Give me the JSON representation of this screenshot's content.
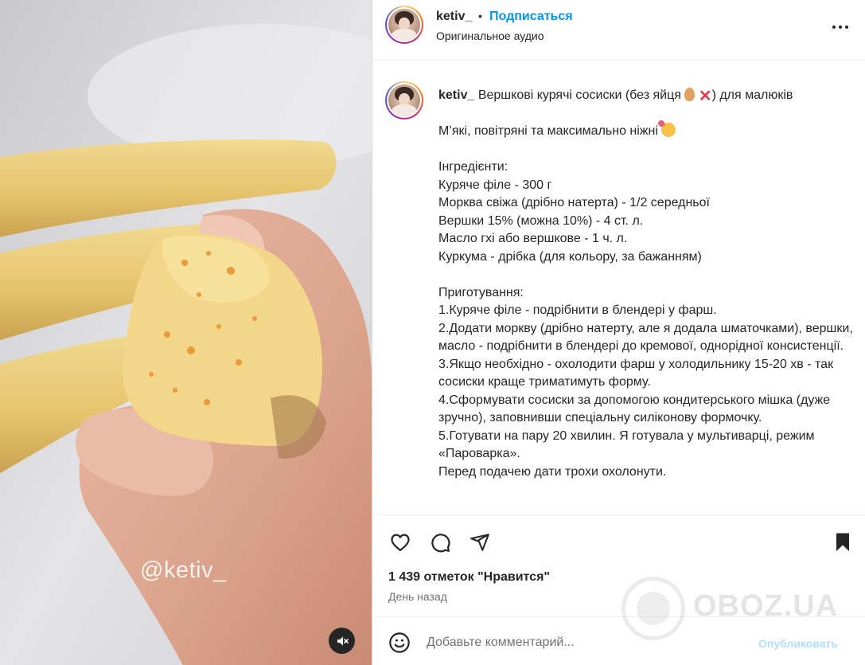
{
  "media": {
    "watermark_handle": "@ketiv_"
  },
  "header": {
    "username": "ketiv_",
    "separator": "•",
    "follow_label": "Подписаться",
    "audio_label": "Оригинальное аудио"
  },
  "caption": {
    "username": "ketiv_",
    "title_before": "Вершкові курячі сосиски (без яйця ",
    "title_after": ") для малюків",
    "tagline": "М’які, повітряні та максимально ніжні",
    "ingredients_header": "Інгредієнти:",
    "ingredients": [
      "Куряче філе - 300 г",
      "Морква свіжа (дрібно натерта) - 1/2 середньої",
      "Вершки 15% (можна 10%) - 4 ст. л.",
      "Масло гхі або вершкове - 1 ч. л.",
      "Куркума - дрібка (для кольору, за бажанням)"
    ],
    "steps_header": "Приготування:",
    "steps": [
      "1.Куряче філе - подрібнити в блендері у фарш.",
      "2.Додати моркву (дрібно натерту, але я додала шматочками), вершки, масло - подрібнити в блендері до кремової, однорідної консистенції.",
      "3.Якщо необхідно - охолодити фарш у холодильнику 15-20 хв - так сосиски краще триматимуть форму.",
      "4.Сформувати сосиски за допомогою кондитерського мішка (дуже зручно), заповнивши спеціальну силіконову формочку.",
      "5.Готувати на пару 20 хвилин. Я готувала у мультиварці, режим «Пароварка».",
      "Перед подачею дати трохи охолонути."
    ]
  },
  "actions": {
    "likes_text": "1 439 отметок \"Нравится\"",
    "date_text": "День назад"
  },
  "comment": {
    "placeholder": "Добавьте комментарий...",
    "publish_label": "Опубликовать"
  },
  "watermark_logo": {
    "text": "OBOZ.UA"
  },
  "colors": {
    "link_blue": "#0095f6",
    "publish_disabled": "#b2dffc",
    "secondary_text": "#737373"
  },
  "icons": [
    "heart-icon",
    "comment-icon",
    "share-icon",
    "bookmark-icon",
    "more-icon",
    "emoji-icon",
    "mute-icon"
  ]
}
